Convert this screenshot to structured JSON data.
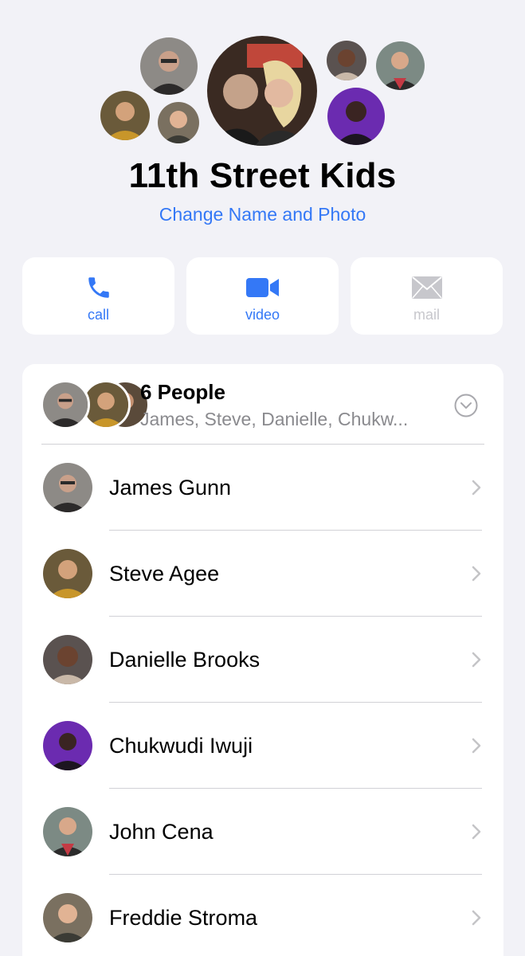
{
  "header": {
    "group_name": "11th Street Kids",
    "change_link": "Change Name and Photo"
  },
  "actions": [
    {
      "label": "call",
      "icon": "phone-icon",
      "enabled": true
    },
    {
      "label": "video",
      "icon": "video-camera-icon",
      "enabled": true
    },
    {
      "label": "mail",
      "icon": "envelope-icon",
      "enabled": false
    }
  ],
  "people_summary": {
    "count_label": "6 People",
    "names_preview": "James, Steve, Danielle, Chukw..."
  },
  "members": [
    {
      "name": "James Gunn"
    },
    {
      "name": "Steve Agee"
    },
    {
      "name": "Danielle Brooks"
    },
    {
      "name": "Chukwudi Iwuji"
    },
    {
      "name": "John Cena"
    },
    {
      "name": "Freddie Stroma"
    }
  ],
  "colors": {
    "accent": "#3478f6",
    "background": "#f2f2f7",
    "disabled": "#c7c7cc"
  }
}
